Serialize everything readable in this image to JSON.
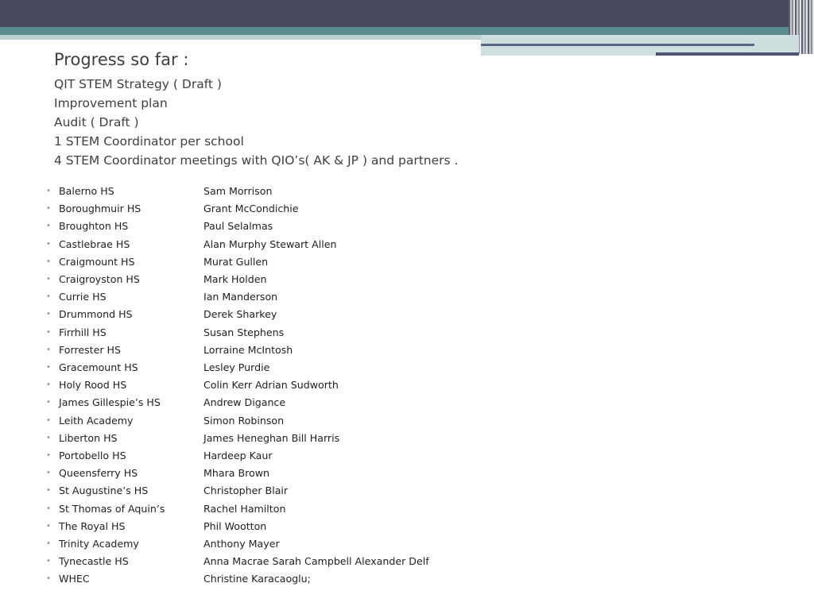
{
  "title": "Progress so far :",
  "intro_lines": [
    "QIT STEM Strategy ( Draft )",
    "Improvement plan",
    "Audit ( Draft )",
    "1 STEM Coordinator per school",
    "4 STEM Coordinator meetings with QIO’s( AK & JP )  and partners ."
  ],
  "bullet_glyph": "•",
  "rows": [
    {
      "school": "Balerno HS",
      "people": "Sam Morrison"
    },
    {
      "school": "Boroughmuir HS",
      "people": "Grant McCondichie"
    },
    {
      "school": "Broughton HS",
      "people": "Paul Selalmas"
    },
    {
      "school": "Castlebrae HS",
      "people": "Alan Murphy Stewart Allen"
    },
    {
      "school": "Craigmount HS",
      "people": "Murat Gullen"
    },
    {
      "school": "Craigroyston HS",
      "people": "Mark Holden"
    },
    {
      "school": "Currie HS",
      "people": "Ian Manderson"
    },
    {
      "school": "Drummond HS",
      "people": "Derek Sharkey"
    },
    {
      "school": "Firrhill HS",
      "people": "Susan Stephens"
    },
    {
      "school": "Forrester HS",
      "people": "Lorraine McIntosh"
    },
    {
      "school": "Gracemount HS",
      "people": "Lesley Purdie"
    },
    {
      "school": "Holy Rood HS",
      "people": "Colin Kerr Adrian Sudworth"
    },
    {
      "school": "James Gillespie’s HS",
      "people": "Andrew Digance"
    },
    {
      "school": "Leith Academy",
      "people": "Simon Robinson"
    },
    {
      "school": "Liberton HS",
      "people": "James Heneghan Bill Harris"
    },
    {
      "school": "Portobello HS",
      "people": "Hardeep Kaur"
    },
    {
      "school": "Queensferry HS",
      "people": "Mhara Brown"
    },
    {
      "school": "St Augustine’s HS",
      "people": "Christopher Blair"
    },
    {
      "school": "St Thomas of Aquin’s",
      "people": "Rachel Hamilton"
    },
    {
      "school": "The Royal HS",
      "people": "Phil Wootton"
    },
    {
      "school": "Trinity Academy",
      "people": "Anthony Mayer"
    },
    {
      "school": "Tynecastle HS",
      "people": "Anna Macrae Sarah Campbell Alexander Delf"
    },
    {
      "school": "WHEC",
      "people": "Christine Karacaoglu;"
    }
  ]
}
